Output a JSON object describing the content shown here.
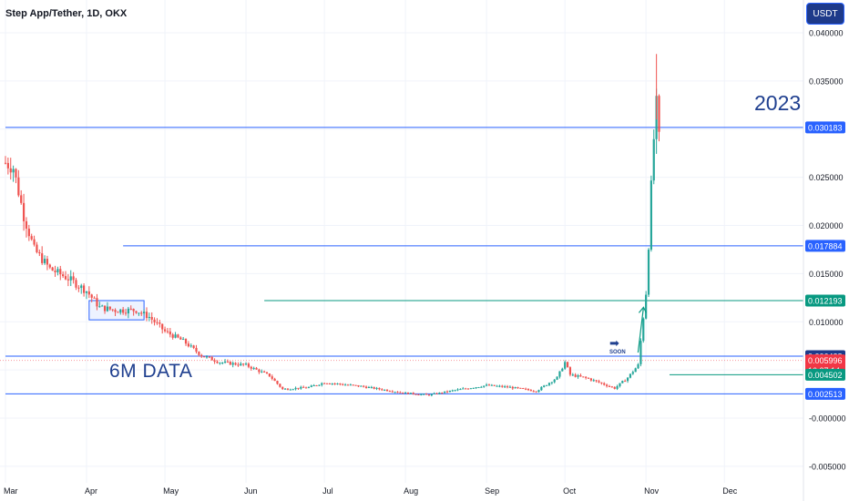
{
  "header": {
    "title": "Step App/Tether, 1D, OKX",
    "currency_button": "USDT"
  },
  "annotations": {
    "six_month": "6M DATA",
    "year": "2023",
    "soon": "SOON"
  },
  "colors": {
    "up": "#26a69a",
    "down": "#ef5350",
    "blue_line": "#2962ff",
    "green_line": "#089981",
    "red_line": "#f23645",
    "label_dark_blue": "#1e3a8a"
  },
  "icons": {
    "soon_arrow": "right-arrow-icon",
    "breakout_arrow": "up-arrow-icon"
  },
  "chart_data": {
    "type": "candlestick",
    "title": "Step App/Tether, 1D, OKX",
    "quote_currency": "USDT",
    "ylim": [
      -0.0055,
      0.041
    ],
    "y_ticks": [
      "0.040000",
      "0.035000",
      "0.025000",
      "0.020000",
      "0.015000",
      "0.010000",
      "-0.000000",
      "-0.005000"
    ],
    "x_labels": [
      "Mar",
      "Apr",
      "May",
      "Jun",
      "Jul",
      "Aug",
      "Sep",
      "Oct",
      "Nov",
      "Dec"
    ],
    "x_label_dates": [
      "2023-03-01",
      "2023-04-01",
      "2023-05-01",
      "2023-06-01",
      "2023-07-01",
      "2023-08-01",
      "2023-09-01",
      "2023-10-01",
      "2023-11-01",
      "2023-12-01"
    ],
    "x_range": [
      "2023-03-01",
      "2023-12-15"
    ],
    "price_levels": [
      {
        "label": "0.030183",
        "value": 0.030183,
        "color": "blue",
        "from": "2023-03-01"
      },
      {
        "label": "0.017884",
        "value": 0.017884,
        "color": "blue",
        "from": "2023-04-15"
      },
      {
        "label": "0.012193",
        "value": 0.012193,
        "color": "green",
        "from": "2023-06-08"
      },
      {
        "label": "0.006428",
        "value": 0.006428,
        "color": "blue",
        "from": "2023-03-01"
      },
      {
        "label": "0.005996",
        "value": 0.005996,
        "color": "red",
        "from": "2023-03-01",
        "sub_label": "16:37:14"
      },
      {
        "label": "0.004502",
        "value": 0.004502,
        "color": "green",
        "from": "2023-11-10"
      },
      {
        "label": "0.002513",
        "value": 0.002513,
        "color": "blue",
        "from": "2023-03-01"
      }
    ],
    "price_anchors": [
      [
        "2023-03-01",
        0.0265
      ],
      [
        "2023-03-04",
        0.026
      ],
      [
        "2023-03-08",
        0.021
      ],
      [
        "2023-03-12",
        0.0175
      ],
      [
        "2023-03-18",
        0.0155
      ],
      [
        "2023-03-25",
        0.0145
      ],
      [
        "2023-04-01",
        0.0132
      ],
      [
        "2023-04-06",
        0.0115
      ],
      [
        "2023-04-12",
        0.0112
      ],
      [
        "2023-04-20",
        0.0112
      ],
      [
        "2023-04-25",
        0.0105
      ],
      [
        "2023-05-01",
        0.009
      ],
      [
        "2023-05-08",
        0.008
      ],
      [
        "2023-05-15",
        0.0065
      ],
      [
        "2023-05-22",
        0.0058
      ],
      [
        "2023-06-01",
        0.0055
      ],
      [
        "2023-06-10",
        0.0044
      ],
      [
        "2023-06-15",
        0.003
      ],
      [
        "2023-06-25",
        0.0032
      ],
      [
        "2023-07-01",
        0.0037
      ],
      [
        "2023-07-15",
        0.0033
      ],
      [
        "2023-08-01",
        0.0026
      ],
      [
        "2023-08-10",
        0.0024
      ],
      [
        "2023-08-20",
        0.0029
      ],
      [
        "2023-09-01",
        0.0034
      ],
      [
        "2023-09-10",
        0.0032
      ],
      [
        "2023-09-20",
        0.0028
      ],
      [
        "2023-09-28",
        0.0042
      ],
      [
        "2023-10-01",
        0.0058
      ],
      [
        "2023-10-03",
        0.0045
      ],
      [
        "2023-10-10",
        0.0041
      ],
      [
        "2023-10-20",
        0.0031
      ],
      [
        "2023-10-25",
        0.0042
      ],
      [
        "2023-10-29",
        0.0055
      ],
      [
        "2023-11-01",
        0.013
      ],
      [
        "2023-11-02",
        0.018
      ],
      [
        "2023-11-03",
        0.024
      ],
      [
        "2023-11-04",
        0.029
      ],
      [
        "2023-11-05",
        0.0325
      ],
      [
        "2023-11-06",
        0.029
      ]
    ],
    "last_price": 0.005996,
    "countdown": "16:37:14",
    "annotations": [
      "6M DATA",
      "2023",
      "SOON"
    ],
    "grid": true
  }
}
